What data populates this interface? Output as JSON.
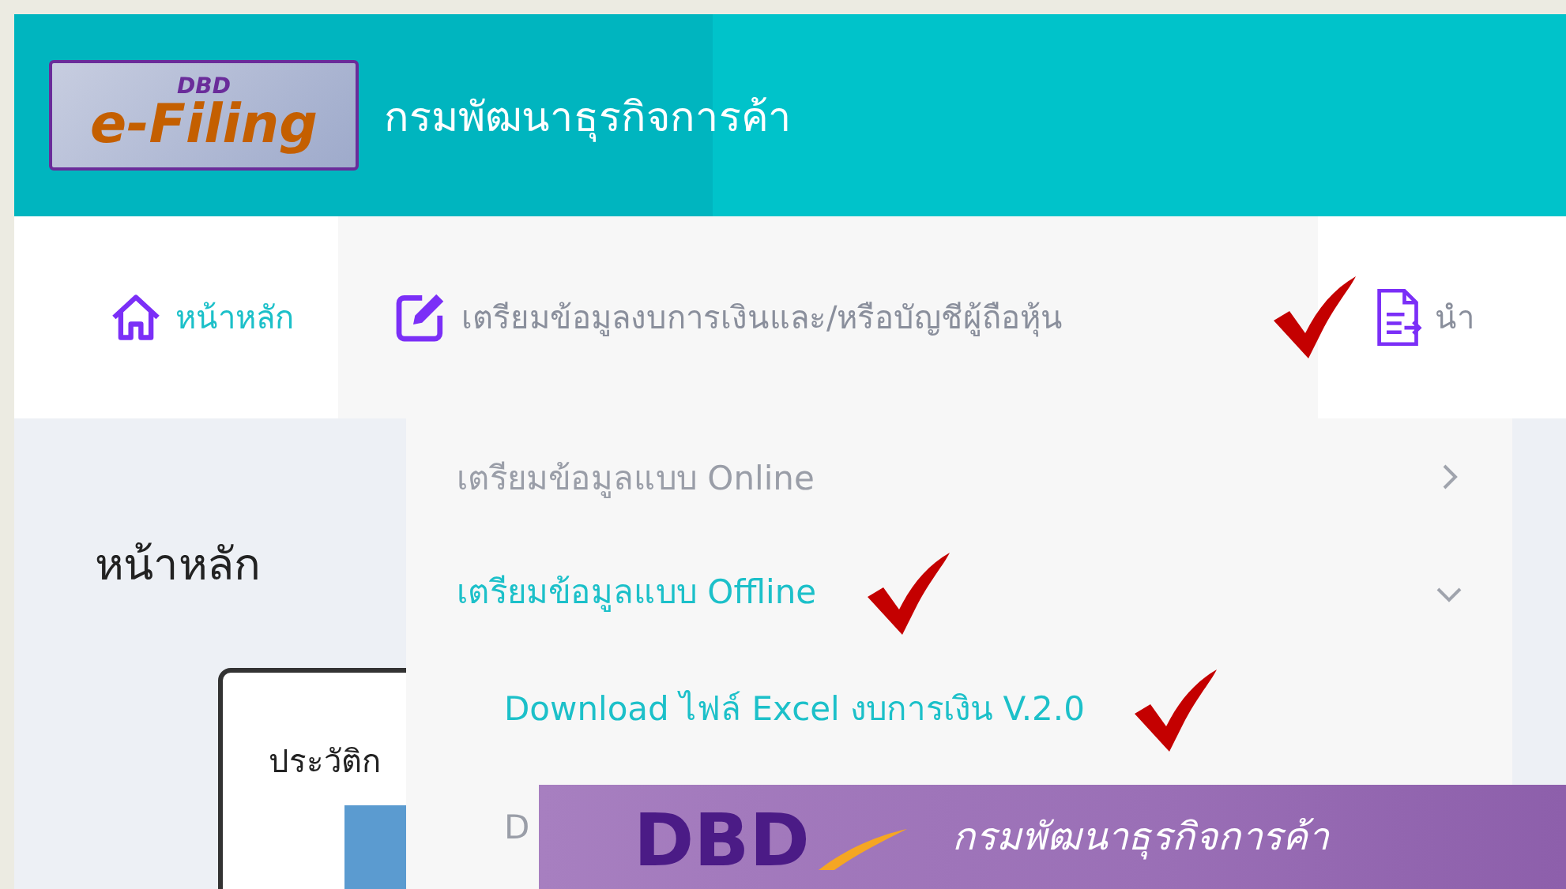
{
  "header": {
    "logo": {
      "top": "DBD",
      "main": "e-Filing"
    },
    "title": "กรมพัฒนาธุรกิจการค้า"
  },
  "nav": [
    {
      "label": "หน้าหลัก",
      "kind": "home",
      "selected": true,
      "expanded": false,
      "annotated": false
    },
    {
      "label": "เตรียมข้อมูลงบการเงินและ/หรือบัญชีผู้ถือหุ้น",
      "kind": "edit",
      "selected": false,
      "expanded": true,
      "annotated": true
    },
    {
      "label": "นำ",
      "kind": "document",
      "selected": false,
      "expanded": false,
      "annotated": false
    }
  ],
  "dropdown": [
    {
      "label": "เตรียมข้อมูลแบบ Online",
      "selected": false,
      "expanded": false,
      "annotated": false
    },
    {
      "label": "เตรียมข้อมูลแบบ Offline",
      "selected": true,
      "expanded": true,
      "annotated": true,
      "children": [
        {
          "label": "Download ไฟล์ Excel งบการเงิน V.2.0",
          "selected": true,
          "annotated": true
        },
        {
          "label": "D",
          "selected": false,
          "annotated": false
        }
      ]
    }
  ],
  "main": {
    "heading": "หน้าหลัก",
    "card": {
      "title": "ประวัติก"
    }
  },
  "banner": {
    "logo": "DBD",
    "title": "กรมพัฒนาธุรกิจการค้า"
  }
}
